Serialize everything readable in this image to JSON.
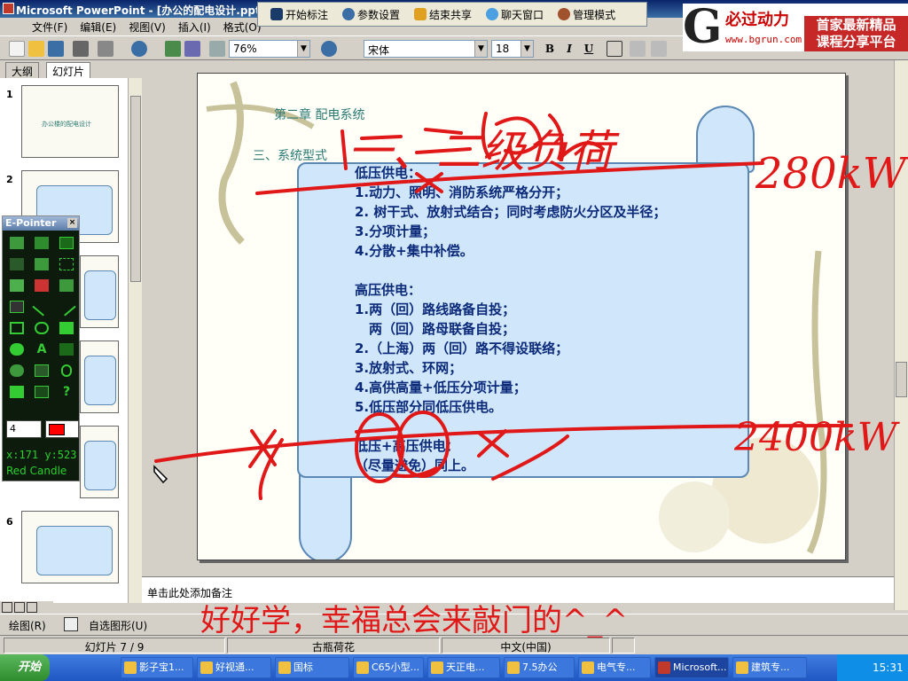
{
  "window": {
    "title": "Microsoft PowerPoint - [办公的配电设计.ppt]"
  },
  "annotation_toolbar": {
    "items": [
      {
        "label": "开始标注",
        "icon": "pen-icon",
        "color": "#1a3a6a"
      },
      {
        "label": "参数设置",
        "icon": "gear-icon",
        "color": "#3a6ea5"
      },
      {
        "label": "结束共享",
        "icon": "stop-icon",
        "color": "#e0a020"
      },
      {
        "label": "聊天窗口",
        "icon": "chat-icon",
        "color": "#4aa0e0"
      },
      {
        "label": "管理模式",
        "icon": "admin-icon",
        "color": "#a0522d"
      }
    ]
  },
  "logo": {
    "brand": "必过动力",
    "url": "www.bgrun.com",
    "tagline_1": "首家最新精品",
    "tagline_2": "课程分享平台"
  },
  "menu": [
    "文件(F)",
    "编辑(E)",
    "视图(V)",
    "插入(I)",
    "格式(O)"
  ],
  "toolbar": {
    "zoom": "76%",
    "font": "宋体",
    "font_size": "18",
    "bold": "B",
    "italic": "I",
    "underline": "U"
  },
  "left_panel": {
    "tabs": [
      "大纲",
      "幻灯片"
    ],
    "active_tab": "幻灯片",
    "thumb_numbers": [
      "1",
      "2",
      "6"
    ],
    "thumb1_title": "办公楼的配电设计"
  },
  "epointer": {
    "title": "E-Pointer",
    "pen_width": "4",
    "coord_x": "x:171",
    "coord_y": "y:523",
    "tool_name": "Red Candle",
    "pen_color": "#ff0000"
  },
  "slide": {
    "chapter": "第二章 配电系统",
    "section": "三、系统型式",
    "lines": [
      "低压供电：",
      "1.动力、照明、消防系统严格分开；",
      "2. 树干式、放射式结合；同时考虑防火分区及半径；",
      "3.分项计量；",
      "4.分散+集中补偿。",
      "",
      "高压供电：",
      "1.两（回）路线路备自投；",
      "两（回）路母联备自投；",
      "2.（上海）两（回）路不得设联络；",
      "3.放射式、环网；",
      "4.高供高量+低压分项计量；",
      "5.低压部分同低压供电。",
      "",
      "低压+高压供电：",
      "（尽量避免）同上。"
    ]
  },
  "handwriting": {
    "note_top": "一、二级负荷",
    "kw_top": "280kW",
    "kw_bottom": "2400kW"
  },
  "notes_placeholder": "单击此处添加备注",
  "bottom_caption": "好好学，幸福总会来敲门的^_^",
  "drawbar": {
    "draw": "绘图(R)",
    "autoshapes": "自选图形(U)"
  },
  "status": {
    "slide_pos": "幻灯片 7 / 9",
    "design": "古瓶荷花",
    "language": "中文(中国)"
  },
  "taskbar": {
    "start": "开始",
    "items": [
      "影子宝1...",
      "好视通...",
      "国标",
      "C65小型...",
      "天正电...",
      "7.5办公",
      "电气专...",
      "Microsoft...",
      "建筑专..."
    ],
    "time": "15:31"
  }
}
